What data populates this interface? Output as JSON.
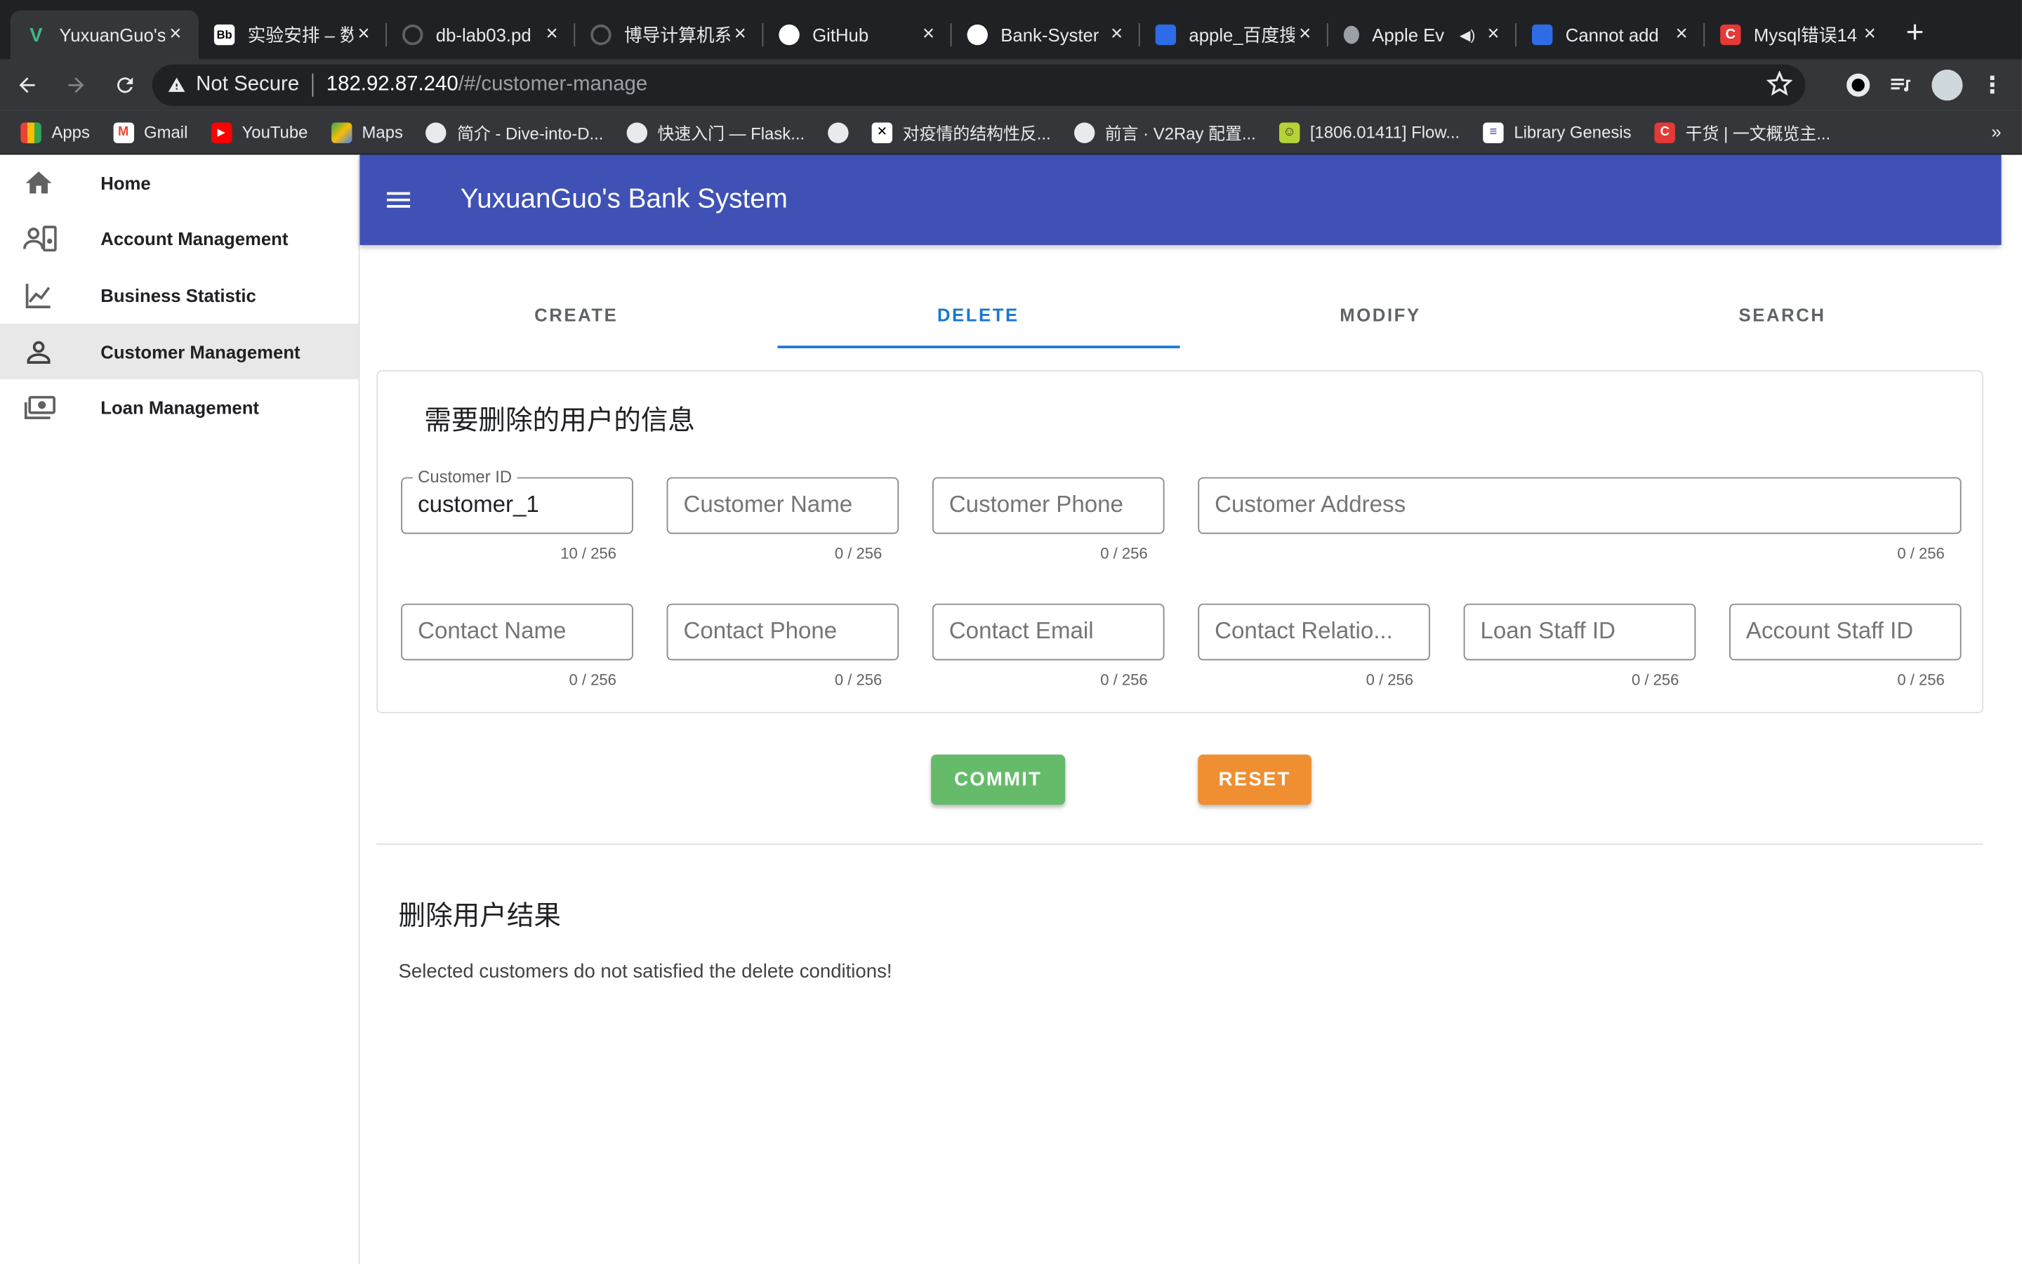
{
  "browser": {
    "tabs": [
      {
        "title": "YuxuanGuo's",
        "favicon": "vue-icon",
        "active": true
      },
      {
        "title": "实验安排 – 数",
        "favicon": "blackboard-icon"
      },
      {
        "title": "db-lab03.pd",
        "favicon": "globe-icon"
      },
      {
        "title": "博导计算机系",
        "favicon": "globe-icon"
      },
      {
        "title": "GitHub",
        "favicon": "github-icon"
      },
      {
        "title": "Bank-Syster",
        "favicon": "github-icon"
      },
      {
        "title": "apple_百度搜",
        "favicon": "baidu-icon"
      },
      {
        "title": "Apple Ev",
        "favicon": "apple-icon",
        "audio": true
      },
      {
        "title": "Cannot add",
        "favicon": "baidu-icon"
      },
      {
        "title": "Mysql错误14",
        "favicon": "csdn-icon"
      }
    ],
    "address": {
      "security_label": "Not Secure",
      "host": "182.92.87.240",
      "path": "/#/customer-manage"
    },
    "bookmarks": [
      {
        "label": "Apps",
        "icon": "apps-grid-icon"
      },
      {
        "label": "Gmail",
        "icon": "gmail-icon"
      },
      {
        "label": "YouTube",
        "icon": "youtube-icon"
      },
      {
        "label": "Maps",
        "icon": "maps-icon"
      },
      {
        "label": "简介 - Dive-into-D...",
        "icon": "globe-icon"
      },
      {
        "label": "快速入门 — Flask...",
        "icon": "globe-icon"
      },
      {
        "label": "",
        "icon": "globe-icon"
      },
      {
        "label": "对疫情的结构性反...",
        "icon": "bookmark-x-icon"
      },
      {
        "label": "前言 · V2Ray 配置...",
        "icon": "globe-icon"
      },
      {
        "label": "[1806.01411] Flow...",
        "icon": "arxiv-icon"
      },
      {
        "label": "Library Genesis",
        "icon": "libgen-icon"
      },
      {
        "label": "干货 | 一文概览主...",
        "icon": "csdn-icon"
      }
    ],
    "bookmarks_more": "»"
  },
  "sidebar": {
    "items": [
      {
        "label": "Home",
        "icon": "home-icon"
      },
      {
        "label": "Account Management",
        "icon": "account-icon"
      },
      {
        "label": "Business Statistic",
        "icon": "chart-line-icon"
      },
      {
        "label": "Customer Management",
        "icon": "person-icon",
        "active": true
      },
      {
        "label": "Loan Management",
        "icon": "cash-icon"
      }
    ]
  },
  "appbar": {
    "title": "YuxuanGuo's Bank System"
  },
  "tabs": [
    "CREATE",
    "DELETE",
    "MODIFY",
    "SEARCH"
  ],
  "active_tab": "DELETE",
  "form": {
    "title": "需要删除的用户的信息",
    "fields": {
      "customer_id": {
        "label": "Customer ID",
        "value": "customer_1",
        "counter": "10 / 256"
      },
      "customer_name": {
        "placeholder": "Customer Name",
        "counter": "0 / 256"
      },
      "customer_phone": {
        "placeholder": "Customer Phone",
        "counter": "0 / 256"
      },
      "customer_address": {
        "placeholder": "Customer Address",
        "counter": "0 / 256"
      },
      "contact_name": {
        "placeholder": "Contact Name",
        "counter": "0 / 256"
      },
      "contact_phone": {
        "placeholder": "Contact Phone",
        "counter": "0 / 256"
      },
      "contact_email": {
        "placeholder": "Contact Email",
        "counter": "0 / 256"
      },
      "contact_relation": {
        "placeholder": "Contact Relatio...",
        "counter": "0 / 256"
      },
      "loan_staff_id": {
        "placeholder": "Loan Staff ID",
        "counter": "0 / 256"
      },
      "account_staff_id": {
        "placeholder": "Account Staff ID",
        "counter": "0 / 256"
      }
    }
  },
  "actions": {
    "commit_label": "COMMIT",
    "reset_label": "RESET"
  },
  "result": {
    "title": "删除用户结果",
    "message": "Selected customers do not satisfied the delete conditions!"
  },
  "colors": {
    "primary": "#3f51b5",
    "tab_active": "#1976d2",
    "commit": "#66bb6a",
    "reset": "#ef8f32"
  }
}
